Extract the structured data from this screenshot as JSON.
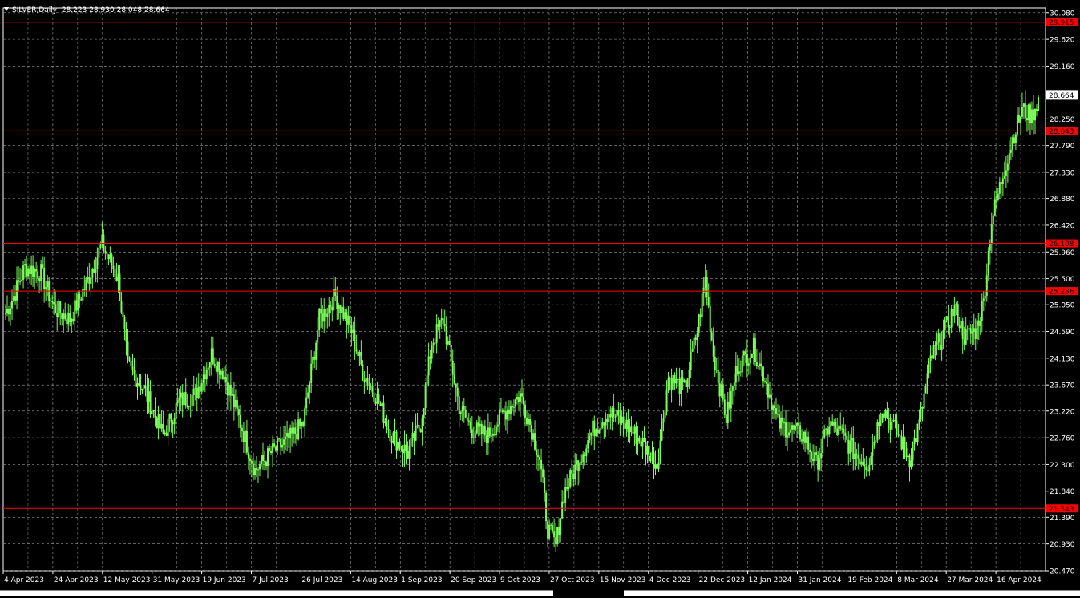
{
  "window": {
    "symbol": "SILVER,Daily",
    "ohlc": [
      "28.223",
      "28.930",
      "28.048",
      "28.664"
    ]
  },
  "colors": {
    "background": "#000000",
    "candle": "#7CFC5A",
    "grid": "#9a9a9a",
    "level_line": "#ff0000",
    "axis_text": "#ffffff"
  },
  "chart_data": {
    "type": "candlestick",
    "title": "SILVER,Daily",
    "ylim": [
      20.47,
      30.16
    ],
    "grid": true,
    "y_ticks": [
      "30.080",
      "29.620",
      "29.160",
      "28.250",
      "27.790",
      "27.330",
      "26.880",
      "26.420",
      "25.960",
      "25.500",
      "25.050",
      "24.590",
      "24.130",
      "23.670",
      "23.220",
      "22.760",
      "22.300",
      "21.840",
      "21.390",
      "20.930",
      "20.470"
    ],
    "x_ticks": [
      "4 Apr 2023",
      "24 Apr 2023",
      "12 May 2023",
      "31 May 2023",
      "19 Jun 2023",
      "7 Jul 2023",
      "26 Jul 2023",
      "14 Aug 2023",
      "1 Sep 2023",
      "20 Sep 2023",
      "9 Oct 2023",
      "27 Oct 2023",
      "15 Nov 2023",
      "4 Dec 2023",
      "22 Dec 2023",
      "12 Jan 2024",
      "31 Jan 2024",
      "19 Feb 2024",
      "8 Mar 2024",
      "27 Mar 2024",
      "16 Apr 2024"
    ],
    "current_price": {
      "value": 28.664,
      "label": "28.664"
    },
    "levels": [
      {
        "value": 29.915,
        "label": "29.915"
      },
      {
        "value": 28.043,
        "label": "28.043"
      },
      {
        "value": 26.108,
        "label": "26.108"
      },
      {
        "value": 25.286,
        "label": "25.286"
      },
      {
        "value": 21.543,
        "label": "21.543"
      }
    ],
    "path_anchors": [
      [
        0,
        24.9
      ],
      [
        5,
        25.2
      ],
      [
        12,
        25.7
      ],
      [
        22,
        25.6
      ],
      [
        30,
        25.0
      ],
      [
        40,
        24.8
      ],
      [
        50,
        25.4
      ],
      [
        60,
        26.1
      ],
      [
        70,
        25.5
      ],
      [
        76,
        24.0
      ],
      [
        86,
        23.6
      ],
      [
        98,
        22.8
      ],
      [
        108,
        23.4
      ],
      [
        118,
        23.5
      ],
      [
        128,
        24.2
      ],
      [
        135,
        23.9
      ],
      [
        145,
        23.1
      ],
      [
        155,
        22.2
      ],
      [
        165,
        22.5
      ],
      [
        175,
        22.7
      ],
      [
        185,
        23.0
      ],
      [
        195,
        24.8
      ],
      [
        205,
        25.2
      ],
      [
        215,
        24.6
      ],
      [
        222,
        23.9
      ],
      [
        230,
        23.5
      ],
      [
        240,
        22.8
      ],
      [
        250,
        22.5
      ],
      [
        258,
        23.0
      ],
      [
        265,
        24.4
      ],
      [
        272,
        24.8
      ],
      [
        282,
        23.3
      ],
      [
        290,
        22.9
      ],
      [
        300,
        22.8
      ],
      [
        310,
        23.2
      ],
      [
        320,
        23.5
      ],
      [
        326,
        23.0
      ],
      [
        332,
        22.4
      ],
      [
        337,
        21.2
      ],
      [
        342,
        20.9
      ],
      [
        347,
        21.8
      ],
      [
        355,
        22.3
      ],
      [
        365,
        22.9
      ],
      [
        375,
        23.2
      ],
      [
        385,
        23.0
      ],
      [
        395,
        22.7
      ],
      [
        405,
        22.3
      ],
      [
        412,
        23.8
      ],
      [
        422,
        23.6
      ],
      [
        430,
        24.6
      ],
      [
        435,
        25.5
      ],
      [
        440,
        24.2
      ],
      [
        448,
        23.1
      ],
      [
        455,
        24.0
      ],
      [
        465,
        24.3
      ],
      [
        472,
        23.8
      ],
      [
        480,
        23.0
      ],
      [
        488,
        22.9
      ],
      [
        496,
        22.8
      ],
      [
        504,
        22.3
      ],
      [
        512,
        23.0
      ],
      [
        520,
        22.8
      ],
      [
        528,
        22.5
      ],
      [
        536,
        22.3
      ],
      [
        545,
        23.3
      ],
      [
        555,
        22.8
      ],
      [
        562,
        22.4
      ],
      [
        568,
        23.0
      ],
      [
        575,
        24.1
      ],
      [
        582,
        24.5
      ],
      [
        590,
        25.0
      ],
      [
        596,
        24.5
      ],
      [
        603,
        24.6
      ],
      [
        608,
        25.1
      ],
      [
        613,
        26.5
      ],
      [
        620,
        27.3
      ],
      [
        627,
        28.0
      ],
      [
        632,
        28.4
      ],
      [
        638,
        28.3
      ],
      [
        642,
        28.6
      ]
    ]
  }
}
